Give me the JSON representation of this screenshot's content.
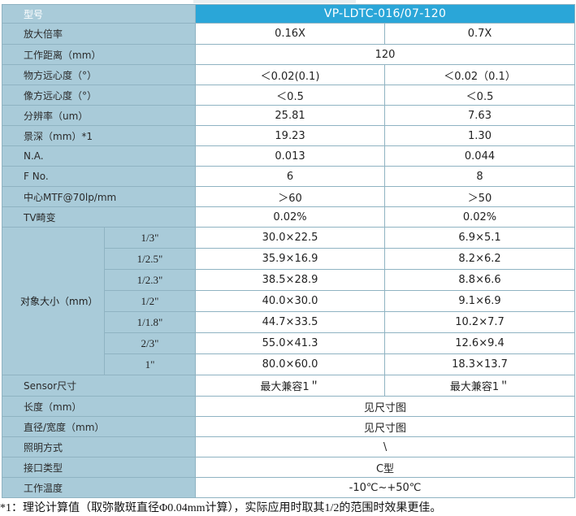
{
  "header": {
    "label": "型号",
    "model": "VP-LDTC-016/07-120"
  },
  "rows": [
    {
      "label": "放大倍率",
      "v1": "0.16X",
      "v2": "0.7X"
    },
    {
      "label": "工作距离（mm）",
      "v": "120"
    },
    {
      "label": "物方远心度（°）",
      "v1": "＜0.02(0.1)",
      "v2": "＜0.02（0.1）"
    },
    {
      "label": "像方远心度（°）",
      "v1": "＜0.5",
      "v2": "＜0.5"
    },
    {
      "label": "分辨率（um）",
      "v1": "25.81",
      "v2": "7.63"
    },
    {
      "label": "景深（mm）*1",
      "v1": "19.23",
      "v2": "1.30"
    },
    {
      "label": "N.A.",
      "v1": "0.013",
      "v2": "0.044"
    },
    {
      "label": "F No.",
      "v1": "6",
      "v2": "8"
    },
    {
      "label": "中心MTF@70lp/mm",
      "v1": "＞60",
      "v2": "＞50"
    },
    {
      "label": "TV畸变",
      "v1": "0.02%",
      "v2": "0.02%"
    }
  ],
  "object_size": {
    "label": "对象大小（mm）",
    "rows": [
      {
        "sensor": "1/3\"",
        "v1": "30.0×22.5",
        "v2": "6.9×5.1"
      },
      {
        "sensor": "1/2.5\"",
        "v1": "35.9×16.9",
        "v2": "8.2×6.2"
      },
      {
        "sensor": "1/2.3\"",
        "v1": "38.5×28.9",
        "v2": "8.8×6.6"
      },
      {
        "sensor": "1/2\"",
        "v1": "40.0×30.0",
        "v2": "9.1×6.9"
      },
      {
        "sensor": "1/1.8\"",
        "v1": "44.7×33.5",
        "v2": "10.2×7.7"
      },
      {
        "sensor": "2/3\"",
        "v1": "55.0×41.3",
        "v2": "12.6×9.4"
      },
      {
        "sensor": "1\"",
        "v1": "80.0×60.0",
        "v2": "18.3×13.7"
      }
    ]
  },
  "sensor_row": {
    "label": "Sensor尺寸",
    "v1": "最大兼容1＂",
    "v2": "最大兼容1＂"
  },
  "tail_rows": [
    {
      "label": "长度（mm）",
      "v": "见尺寸图"
    },
    {
      "label": "直径/宽度（mm）",
      "v": "见尺寸图"
    },
    {
      "label": "照明方式",
      "v": "\\"
    },
    {
      "label": "接口类型",
      "v": "C型"
    },
    {
      "label": "工作温度",
      "v": "-10℃~+50℃"
    }
  ],
  "footnote": "*1：理论计算值（取弥散斑直径Φ0.04mm计算），实际应用时取其1/2的范围时效果更佳。",
  "colors": {
    "label_bg": "#a9cbd9",
    "header_bg": "#2aa6d8",
    "border": "#8fb3c2"
  }
}
